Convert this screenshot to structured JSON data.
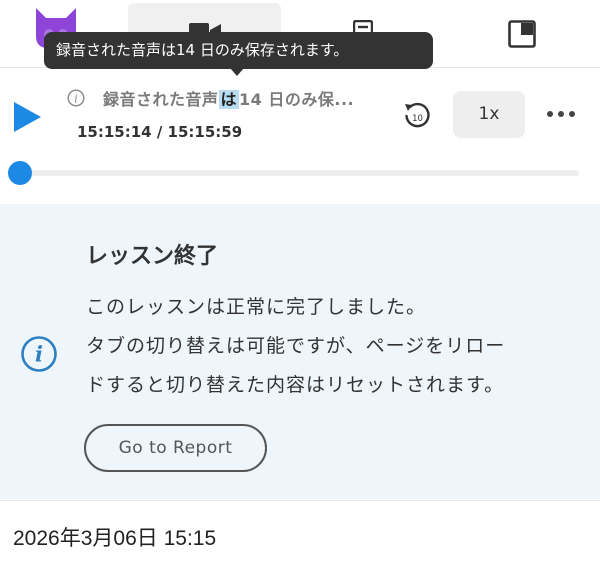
{
  "tooltip": {
    "text": "録音された音声は14 日のみ保存されます。"
  },
  "player": {
    "title_before": "録音された音声",
    "title_highlight": "は",
    "title_after": "14 日のみ保...",
    "time": "15:15:14 / 15:15:59",
    "rewind_label": "10",
    "speed": "1x",
    "progress": 0.0
  },
  "lesson": {
    "title": "レッスン終了",
    "lines": [
      "このレッスンは正常に完了しました。",
      "タブの切り替えは可能ですが、ページをリロー",
      "ドすると切り替えた内容はリセットされます。"
    ],
    "report_button": "Go to Report"
  },
  "footer": {
    "datetime": "2026年3月06日 15:15"
  },
  "colors": {
    "accent": "#1e88e5",
    "logo": "#8e44d6",
    "card_bg": "#eef6fb",
    "info_icon": "#2d7fc1"
  },
  "icons": [
    "logo-icon",
    "video-icon",
    "document-icon",
    "layout-icon",
    "play-icon",
    "info-icon",
    "rewind-10-icon",
    "more-icon"
  ]
}
